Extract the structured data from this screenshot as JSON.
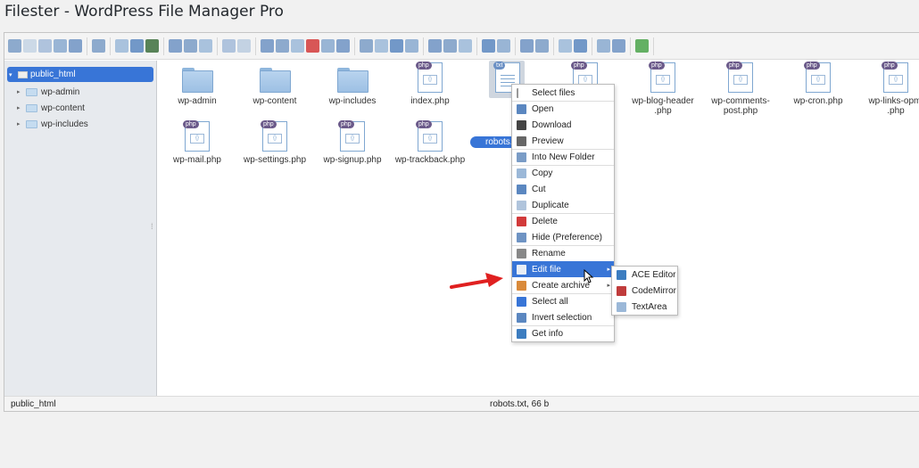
{
  "page": {
    "title": "Filester - WordPress File Manager Pro"
  },
  "toolbar": {
    "groups": [
      [
        "home-icon",
        "back-icon",
        "forward-icon",
        "up-icon",
        "reload-icon"
      ],
      [
        "netmount-icon"
      ],
      [
        "upload-icon",
        "download-icon",
        "save-icon"
      ],
      [
        "open-icon",
        "save-as-icon",
        "select-icon"
      ],
      [
        "undo-icon",
        "redo-icon"
      ],
      [
        "copy-icon",
        "cut-icon",
        "paste-icon",
        "delete-icon",
        "empty-icon",
        "hide-icon"
      ],
      [
        "duplicate-icon",
        "rename-icon",
        "edit-icon",
        "resize-icon"
      ],
      [
        "select-all-icon",
        "invert-icon",
        "deselect-icon"
      ],
      [
        "preview-icon",
        "info-icon"
      ],
      [
        "archive-icon",
        "extract-icon"
      ],
      [
        "view-list-icon",
        "sort-icon"
      ],
      [
        "preferences-icon",
        "help-icon"
      ],
      [
        "fullscreen-icon"
      ]
    ]
  },
  "sidebar": {
    "root": "public_html",
    "items": [
      "wp-admin",
      "wp-content",
      "wp-includes"
    ],
    "grip": "⁞"
  },
  "files": [
    {
      "name": "wp-admin",
      "type": "folder"
    },
    {
      "name": "wp-content",
      "type": "folder"
    },
    {
      "name": "wp-includes",
      "type": "folder"
    },
    {
      "name": "index.php",
      "type": "php"
    },
    {
      "name": "robots.txt",
      "type": "txt"
    },
    {
      "name": "",
      "type": "php"
    },
    {
      "name": "wp-blog-header.php",
      "label_lines": [
        "wp-blog-header",
        ".php"
      ],
      "type": "php"
    },
    {
      "name": "wp-comments-post.php",
      "label_lines": [
        "wp-comments-",
        "post.php"
      ],
      "type": "php"
    },
    {
      "name": "wp-cron.php",
      "type": "php"
    },
    {
      "name": "wp-links-opml.php",
      "label_lines": [
        "wp-links-opml",
        ".php"
      ],
      "type": "php"
    },
    {
      "name": "wp-mail.php",
      "type": "php"
    },
    {
      "name": "wp-settings.php",
      "type": "php"
    },
    {
      "name": "wp-signup.php",
      "type": "php"
    },
    {
      "name": "wp-trackback.php",
      "type": "php"
    }
  ],
  "badges": {
    "php": "php",
    "txt": "txt"
  },
  "selected_label": "robots.txt",
  "status": {
    "left": "public_html",
    "center": "robots.txt, 66 b"
  },
  "context_menu": {
    "items": [
      {
        "label": "Select files",
        "icon": "cursor-icon"
      },
      {
        "label": "Open",
        "icon": "open-icon",
        "sep": true
      },
      {
        "label": "Download",
        "icon": "download-icon"
      },
      {
        "label": "Preview",
        "icon": "eye-icon"
      },
      {
        "label": "Into New Folder",
        "icon": "folder-icon",
        "sep": true
      },
      {
        "label": "Copy",
        "icon": "copy-icon",
        "sep": true
      },
      {
        "label": "Cut",
        "icon": "scissors-icon"
      },
      {
        "label": "Duplicate",
        "icon": "duplicate-icon"
      },
      {
        "label": "Delete",
        "icon": "delete-icon",
        "sep": true
      },
      {
        "label": "Hide (Preference)",
        "icon": "hide-icon"
      },
      {
        "label": "Rename",
        "icon": "rename-icon",
        "sep": true
      },
      {
        "label": "Edit file",
        "icon": "edit-icon",
        "active": true,
        "submenu": true
      },
      {
        "label": "Create archive",
        "icon": "archive-icon",
        "submenu": true
      },
      {
        "label": "Select all",
        "icon": "select-all-icon",
        "sep": true
      },
      {
        "label": "Invert selection",
        "icon": "invert-icon"
      },
      {
        "label": "Get info",
        "icon": "info-icon",
        "sep": true
      }
    ]
  },
  "submenu": {
    "items": [
      {
        "label": "ACE Editor",
        "icon": "cloud-icon"
      },
      {
        "label": "CodeMirror",
        "icon": "codemirror-icon"
      },
      {
        "label": "TextArea",
        "icon": "textarea-icon"
      }
    ]
  },
  "colors": {
    "accent": "#3875d7",
    "annotation": "#e02020"
  },
  "glyphs": {
    "arrow_right": "▸",
    "arrow_down": "▾"
  }
}
